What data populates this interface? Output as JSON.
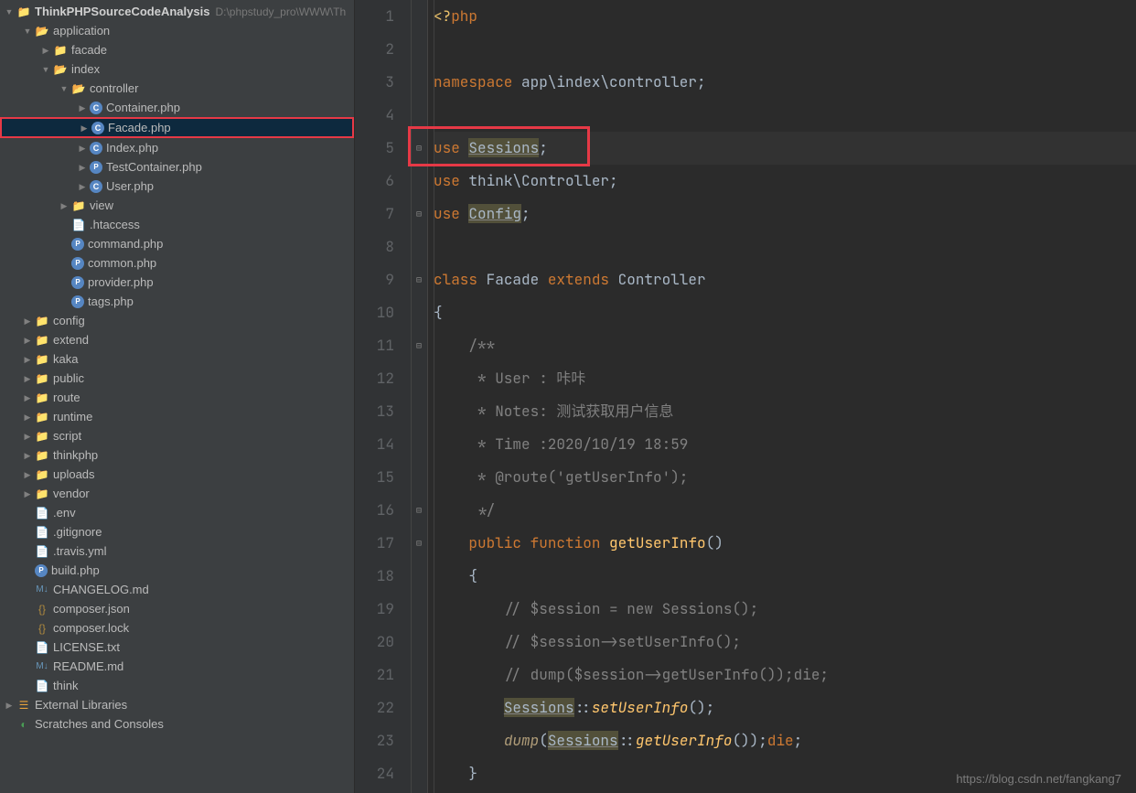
{
  "project": {
    "name": "ThinkPHPSourceCodeAnalysis",
    "path": "D:\\phpstudy_pro\\WWW\\Th"
  },
  "tree": {
    "application": "application",
    "facade": "facade",
    "index": "index",
    "controller": "controller",
    "container_php": "Container.php",
    "facade_php": "Facade.php",
    "index_php": "Index.php",
    "testcontainer_php": "TestContainer.php",
    "user_php": "User.php",
    "view": "view",
    "htaccess": ".htaccess",
    "command_php": "command.php",
    "common_php": "common.php",
    "provider_php": "provider.php",
    "tags_php": "tags.php",
    "config": "config",
    "extend": "extend",
    "kaka": "kaka",
    "public": "public",
    "route": "route",
    "runtime": "runtime",
    "script": "script",
    "thinkphp": "thinkphp",
    "uploads": "uploads",
    "vendor": "vendor",
    "env": ".env",
    "gitignore": ".gitignore",
    "travis": ".travis.yml",
    "build_php": "build.php",
    "changelog": "CHANGELOG.md",
    "composer_json": "composer.json",
    "composer_lock": "composer.lock",
    "license": "LICENSE.txt",
    "readme": "README.md",
    "think_f": "think",
    "ext_libs": "External Libraries",
    "scratches": "Scratches and Consoles"
  },
  "code": {
    "l1_open": "<?php",
    "l3_ns": "namespace",
    "l3_path": " app\\index\\controller;",
    "l5_use": "use",
    "l5_cls": "Sessions",
    "l6_use": "use",
    "l6_cls": " think\\Controller;",
    "l7_use": "use",
    "l7_cls": "Config",
    "l9_class": "class",
    "l9_name": " Facade ",
    "l9_ext": "extends",
    "l9_base": " Controller",
    "l10_ob": "{",
    "l11_c": "/**",
    "l12_c": " * User : 咔咔",
    "l13_c": " * Notes: 测试获取用户信息",
    "l14_c": " * Time :2020/10/19 18:59",
    "l15_c": " * @route('getUserInfo');",
    "l16_c": " */",
    "l17_pub": "public",
    "l17_fn": "function",
    "l17_name": "getUserInfo",
    "l18_ob": "{",
    "l19_c": "// $session = new Sessions();",
    "l20_c": "// $session->setUserInfo();",
    "l21_c": "// dump($session->getUserInfo());die;",
    "l22_cls": "Sessions",
    "l22_fn": "setUserInfo",
    "l23_dump": "dump",
    "l23_cls": "Sessions",
    "l23_fn": "getUserInfo",
    "l23_die": "die",
    "l24_cb": "}"
  },
  "watermark": "https://blog.csdn.net/fangkang7"
}
